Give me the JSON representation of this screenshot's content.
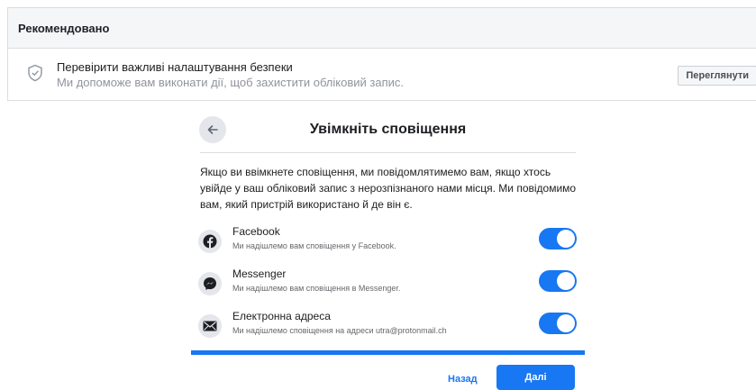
{
  "recommended": {
    "header": "Рекомендовано",
    "item_title": "Перевірити важливі налаштування безпеки",
    "item_subtitle": "Ми допоможе вам виконати дії, щоб захистити обліковий запис.",
    "review_button": "Переглянути",
    "icon": "shield-check-icon"
  },
  "dialog": {
    "title": "Увімкніть сповіщення",
    "back_icon": "arrow-left-icon",
    "description": "Якщо ви ввімкнете сповіщення, ми повідомлятимемо вам, якщо хтось увійде у ваш обліковий запис з нерозпізнаного нами місця. Ми повідомимо вам, який пристрій використано й де він є.",
    "options": [
      {
        "title": "Facebook",
        "subtitle": "Ми надішлемо вам сповіщення у Facebook.",
        "icon": "facebook-icon",
        "enabled": true
      },
      {
        "title": "Messenger",
        "subtitle": "Ми надішлемо вам сповіщення в Messenger.",
        "icon": "messenger-icon",
        "enabled": true
      },
      {
        "title": "Електронна адреса",
        "subtitle": "Ми надішлемо сповіщення на адреси utra@protonmail.ch",
        "icon": "envelope-icon",
        "enabled": true
      }
    ],
    "back_button": "Назад",
    "next_button": "Далі"
  },
  "colors": {
    "accent": "#1877f2",
    "header_bg": "#f5f6f7",
    "border": "#dadde1"
  }
}
